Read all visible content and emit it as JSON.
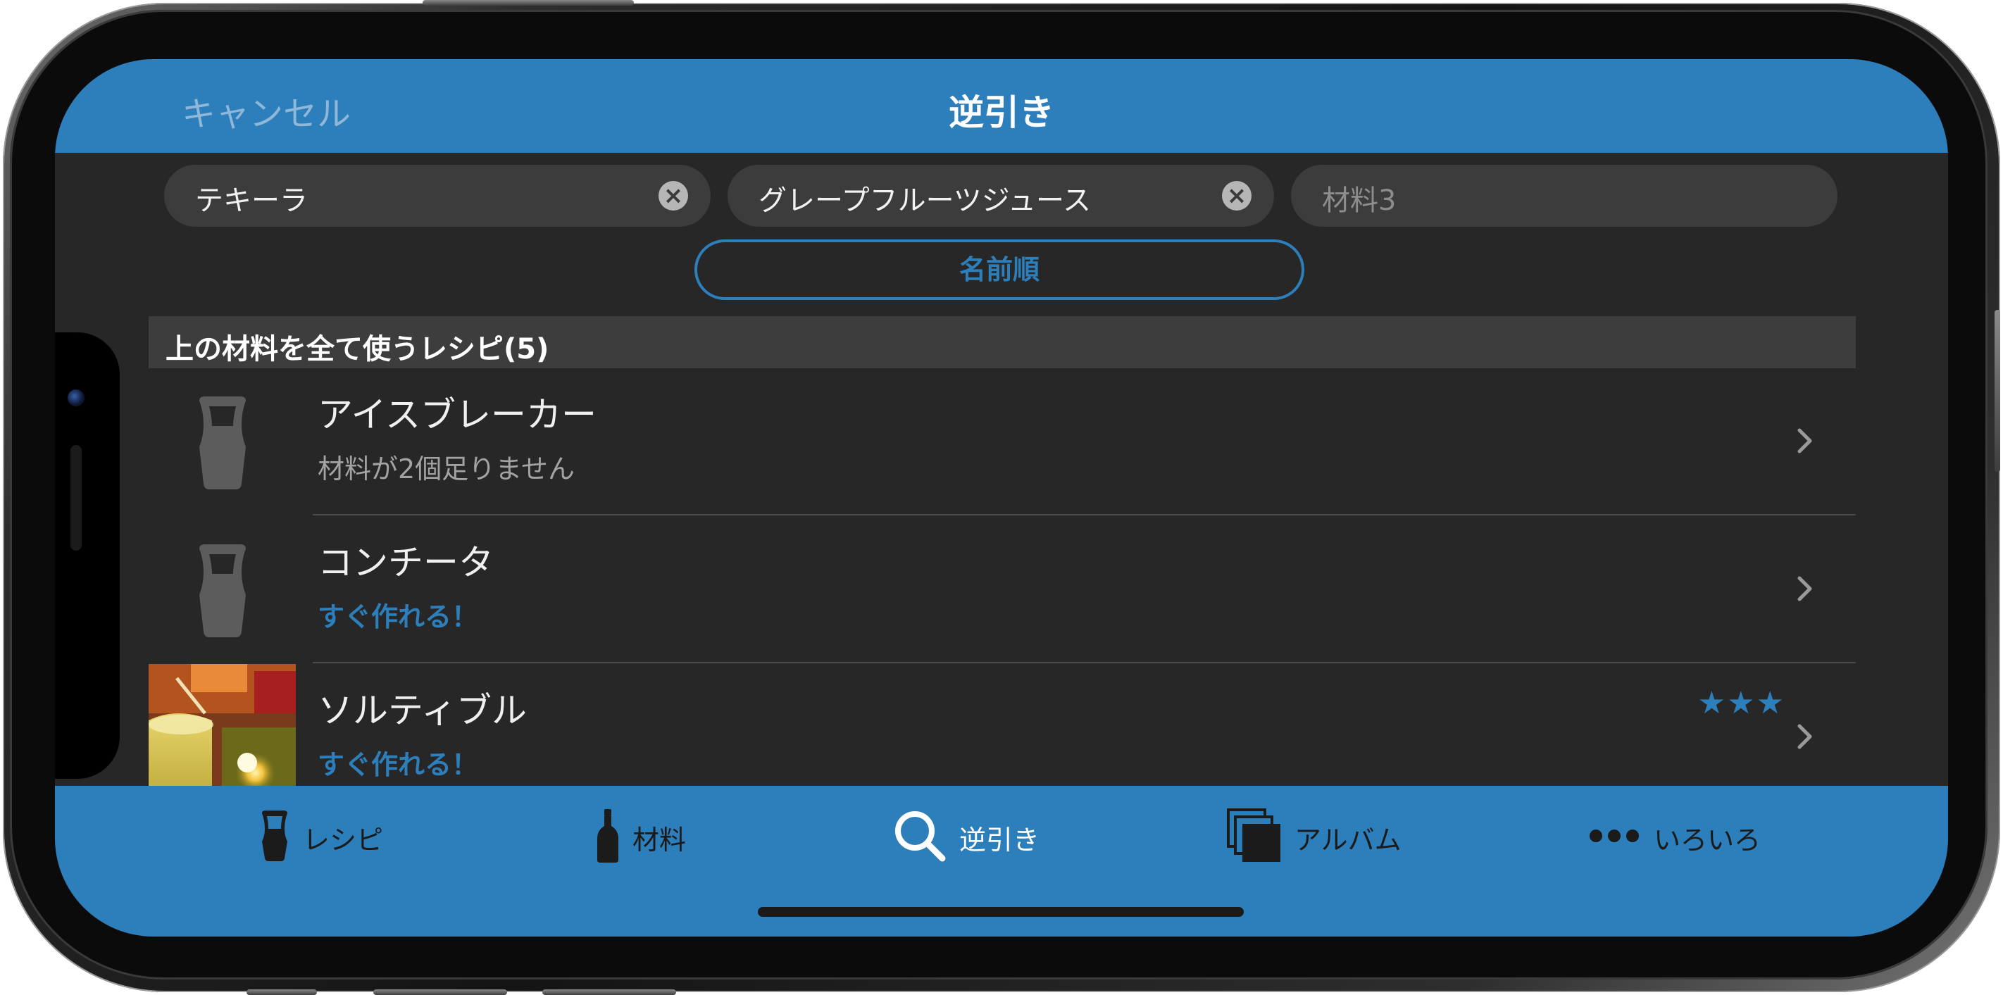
{
  "nav": {
    "cancel_label": "キャンセル",
    "title": "逆引き"
  },
  "search": {
    "field1_value": "テキーラ",
    "field2_value": "グレープフルーツジュース",
    "field3_placeholder": "材料3",
    "clear_glyph": "×"
  },
  "sort": {
    "label": "名前順"
  },
  "section": {
    "header": "上の材料を全て使うレシピ(5)"
  },
  "recipes": [
    {
      "name": "アイスブレーカー",
      "status": "材料が2個足りません",
      "thumbnail": "glass-icon"
    },
    {
      "name": "コンチータ",
      "status": "すぐ作れる！",
      "thumbnail": "glass-icon"
    },
    {
      "name": "ソルティブル",
      "status": "すぐ作れる！",
      "thumbnail": "photo",
      "stars": "★★★"
    }
  ],
  "tabs": [
    {
      "label": "レシピ",
      "icon": "glass-icon"
    },
    {
      "label": "材料",
      "icon": "bottle-icon"
    },
    {
      "label": "逆引き",
      "icon": "search-icon",
      "active": true
    },
    {
      "label": "アルバム",
      "icon": "album-icon"
    },
    {
      "label": "いろいろ",
      "icon": "more-icon"
    }
  ],
  "colors": {
    "accent": "#2c7fbb",
    "background": "#272727",
    "field": "#3c3c3c",
    "section_header": "#3d3d3d"
  }
}
